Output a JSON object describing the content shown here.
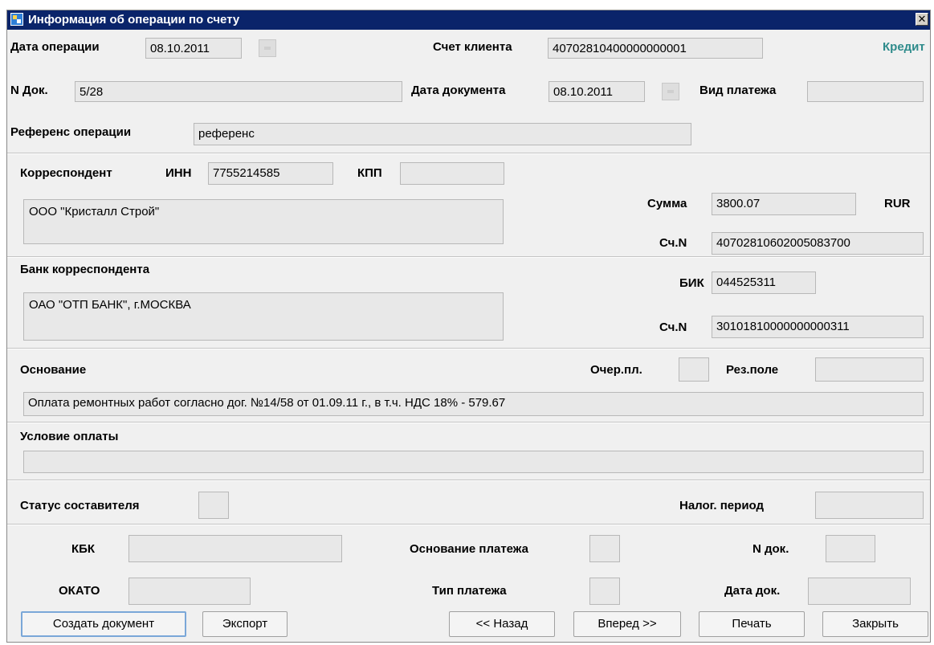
{
  "window": {
    "title": "Информация об операции по счету"
  },
  "operation": {
    "date_label": "Дата операции",
    "date_value": "08.10.2011",
    "client_account_label": "Счет клиента",
    "client_account_value": "40702810400000000001",
    "direction": "Кредит",
    "doc_num_label": "N Док.",
    "doc_num_value": "5/28",
    "doc_date_label": "Дата документа",
    "doc_date_value": "08.10.2011",
    "payment_kind_label": "Вид платежа",
    "payment_kind_value": "",
    "reference_label": "Референс операции",
    "reference_value": "референс"
  },
  "correspondent": {
    "label": "Корреспондент",
    "inn_label": "ИНН",
    "inn_value": "7755214585",
    "kpp_label": "КПП",
    "kpp_value": "",
    "name": "ООО \"Кристалл Строй\"",
    "sum_label": "Сумма",
    "sum_value": "3800.07",
    "currency": "RUR",
    "account_label": "Сч.N",
    "account_value": "40702810602005083700"
  },
  "bank": {
    "label": "Банк корреспондента",
    "name": "ОАО \"ОТП БАНК\", г.МОСКВА",
    "bik_label": "БИК",
    "bik_value": "044525311",
    "account_label": "Сч.N",
    "account_value": "30101810000000000311"
  },
  "basis": {
    "label": "Основание",
    "queue_label": "Очер.пл.",
    "queue_value": "",
    "reserve_label": "Рез.поле",
    "reserve_value": "",
    "text": "Оплата ремонтных работ согласно дог. №14/58 от 01.09.11 г., в т.ч. НДС 18% - 579.67"
  },
  "payment_terms": {
    "label": "Условие оплаты",
    "value": ""
  },
  "tax": {
    "status_label": "Статус составителя",
    "status_value": "",
    "period_label": "Налог. период",
    "period_value": "",
    "kbk_label": "КБК",
    "kbk_value": "",
    "okato_label": "ОКАТО",
    "okato_value": "",
    "payment_basis_label": "Основание платежа",
    "payment_basis_value": "",
    "payment_type_label": "Тип платежа",
    "payment_type_value": "",
    "doc_num_label": "N док.",
    "doc_num_value": "",
    "doc_date_label": "Дата док.",
    "doc_date_value": ""
  },
  "buttons": {
    "create": "Создать документ",
    "export": "Экспорт",
    "back": "<< Назад",
    "forward": "Вперед >>",
    "print": "Печать",
    "close": "Закрыть"
  }
}
